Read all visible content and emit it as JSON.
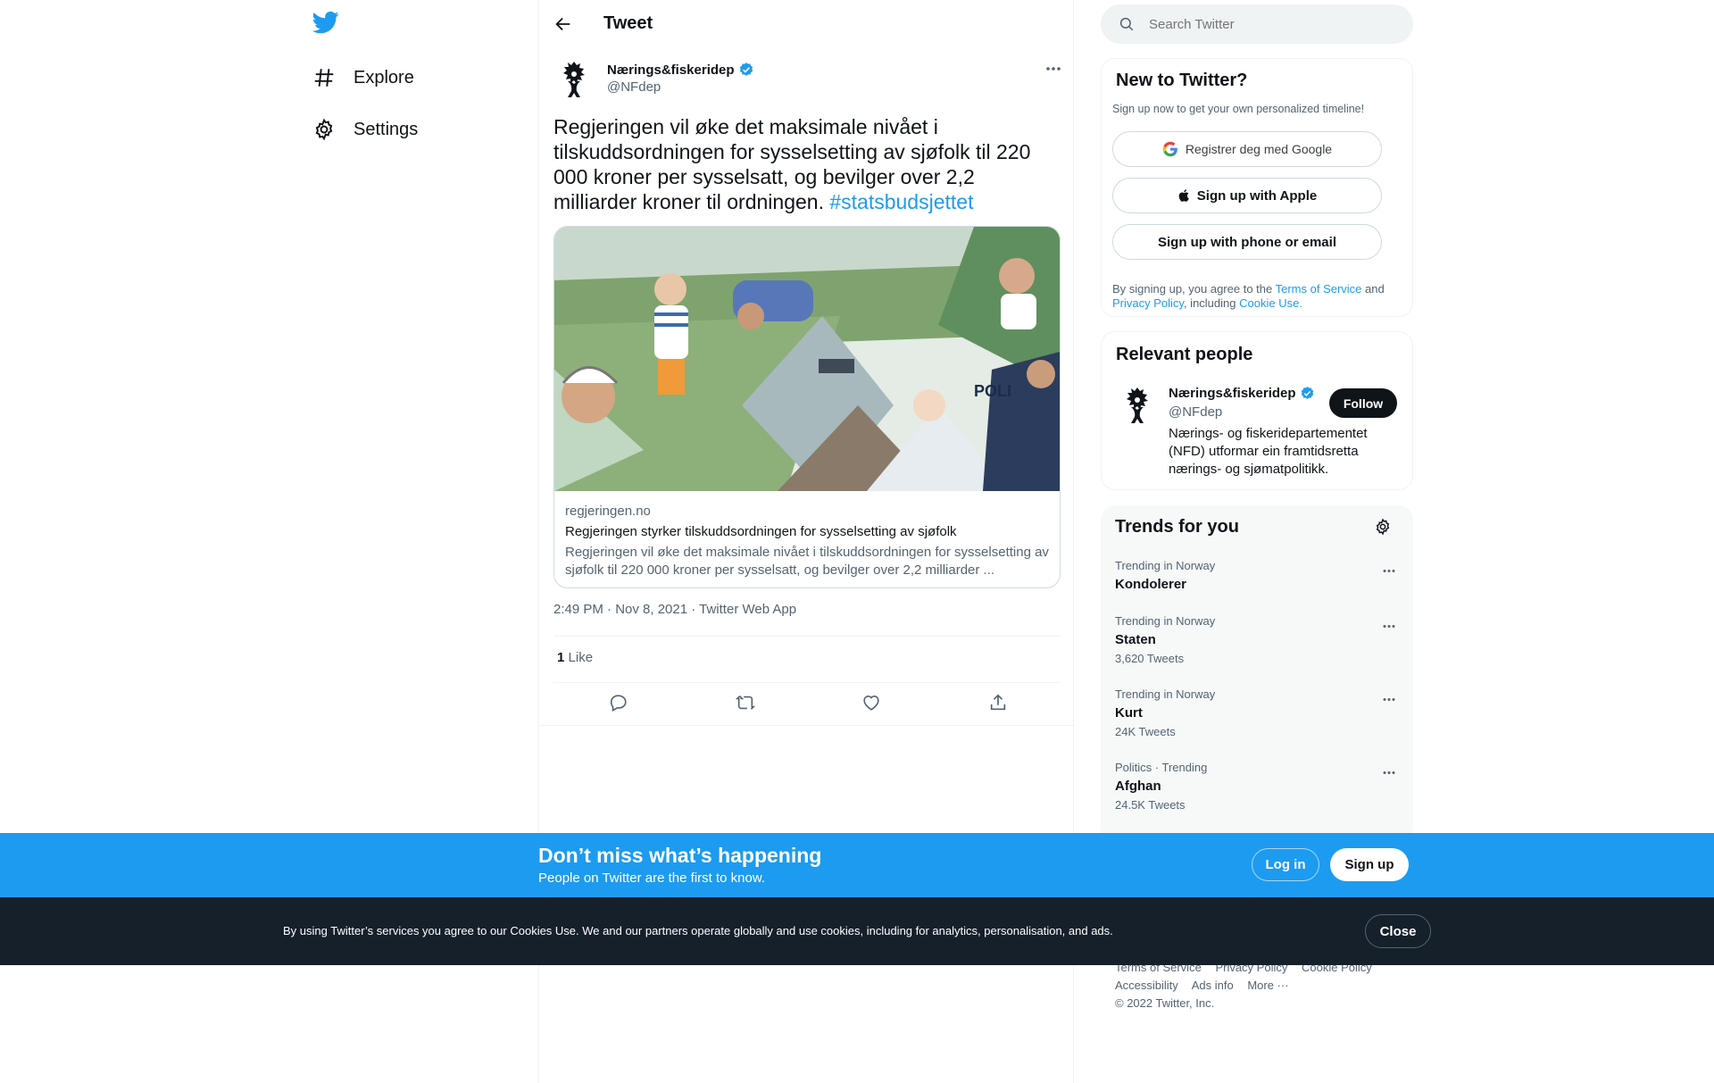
{
  "colors": {
    "accent": "#1d9bf0",
    "text": "#0f1419",
    "muted": "#536471",
    "cookie_bg": "#15202b"
  },
  "nav": {
    "logo_icon": "twitter-bird-icon",
    "items": [
      {
        "label": "Explore",
        "icon": "hashtag-icon"
      },
      {
        "label": "Settings",
        "icon": "gear-icon"
      }
    ]
  },
  "header": {
    "title": "Tweet",
    "back_icon": "back-arrow-icon"
  },
  "tweet": {
    "author_name": "Nærings&fiskeridep",
    "author_handle": "@NFdep",
    "verified_icon": "verified-badge-icon",
    "text": "Regjeringen vil øke det maksimale nivået i tilskuddsordningen for sysselsetting av sjøfolk til 220 000 kroner per sysselsatt, og bevilger over 2,2 milliarder kroner til ordningen. ",
    "hashtag": "#statsbudsjettet",
    "card": {
      "domain": "regjeringen.no",
      "title": "Regjeringen styrker tilskuddsordningen for sysselsetting av sjøfolk",
      "description": "Regjeringen vil øke det maksimale nivået i tilskuddsordningen for sysselsetting av sjøfolk til 220 000 kroner per sysselsatt, og bevilger over 2,2 milliarder ..."
    },
    "timestamp": "2:49 PM · Nov 8, 2021 · Twitter Web App",
    "likes_count": "1",
    "likes_label": "Like",
    "actions": [
      "reply-icon",
      "retweet-icon",
      "like-icon",
      "share-icon"
    ]
  },
  "search": {
    "placeholder": "Search Twitter"
  },
  "new_to_twitter": {
    "title": "New to Twitter?",
    "subtitle": "Sign up now to get your own personalized timeline!",
    "google_label": "Registrer deg med Google",
    "apple_label": "Sign up with Apple",
    "phone_label": "Sign up with phone or email",
    "legal_prefix": "By signing up, you agree to the ",
    "terms": "Terms of Service",
    "and": " and ",
    "privacy": "Privacy Policy",
    "including": ", including ",
    "cookie": "Cookie Use."
  },
  "relevant_people": {
    "title": "Relevant people",
    "name": "Nærings&fiskeridep",
    "handle": "@NFdep",
    "bio": "Nærings- og fiskeridepartementet (NFD) utformar ein framtidsretta nærings- og sjømatpolitikk.",
    "follow_label": "Follow"
  },
  "trends": {
    "title": "Trends for you",
    "items": [
      {
        "context": "Trending in Norway",
        "name": "Kondolerer",
        "count": ""
      },
      {
        "context": "Trending in Norway",
        "name": "Staten",
        "count": "3,620 Tweets"
      },
      {
        "context": "Trending in Norway",
        "name": "Kurt",
        "count": "24K Tweets"
      },
      {
        "context": "Politics · Trending",
        "name": "Afghan",
        "count": "24.5K Tweets"
      }
    ]
  },
  "footer": {
    "links_row1": [
      "Terms of Service",
      "Privacy Policy",
      "Cookie Policy"
    ],
    "links_row2": [
      "Accessibility",
      "Ads info",
      "More ···"
    ],
    "copyright": "© 2022 Twitter, Inc."
  },
  "signup_bar": {
    "title": "Don’t miss what’s happening",
    "subtitle": "People on Twitter are the first to know.",
    "login_label": "Log in",
    "signup_label": "Sign up"
  },
  "cookie_bar": {
    "text": "By using Twitter’s services you agree to our Cookies Use. We and our partners operate globally and use cookies, including for analytics, personalisation, and ads.",
    "close_label": "Close"
  }
}
